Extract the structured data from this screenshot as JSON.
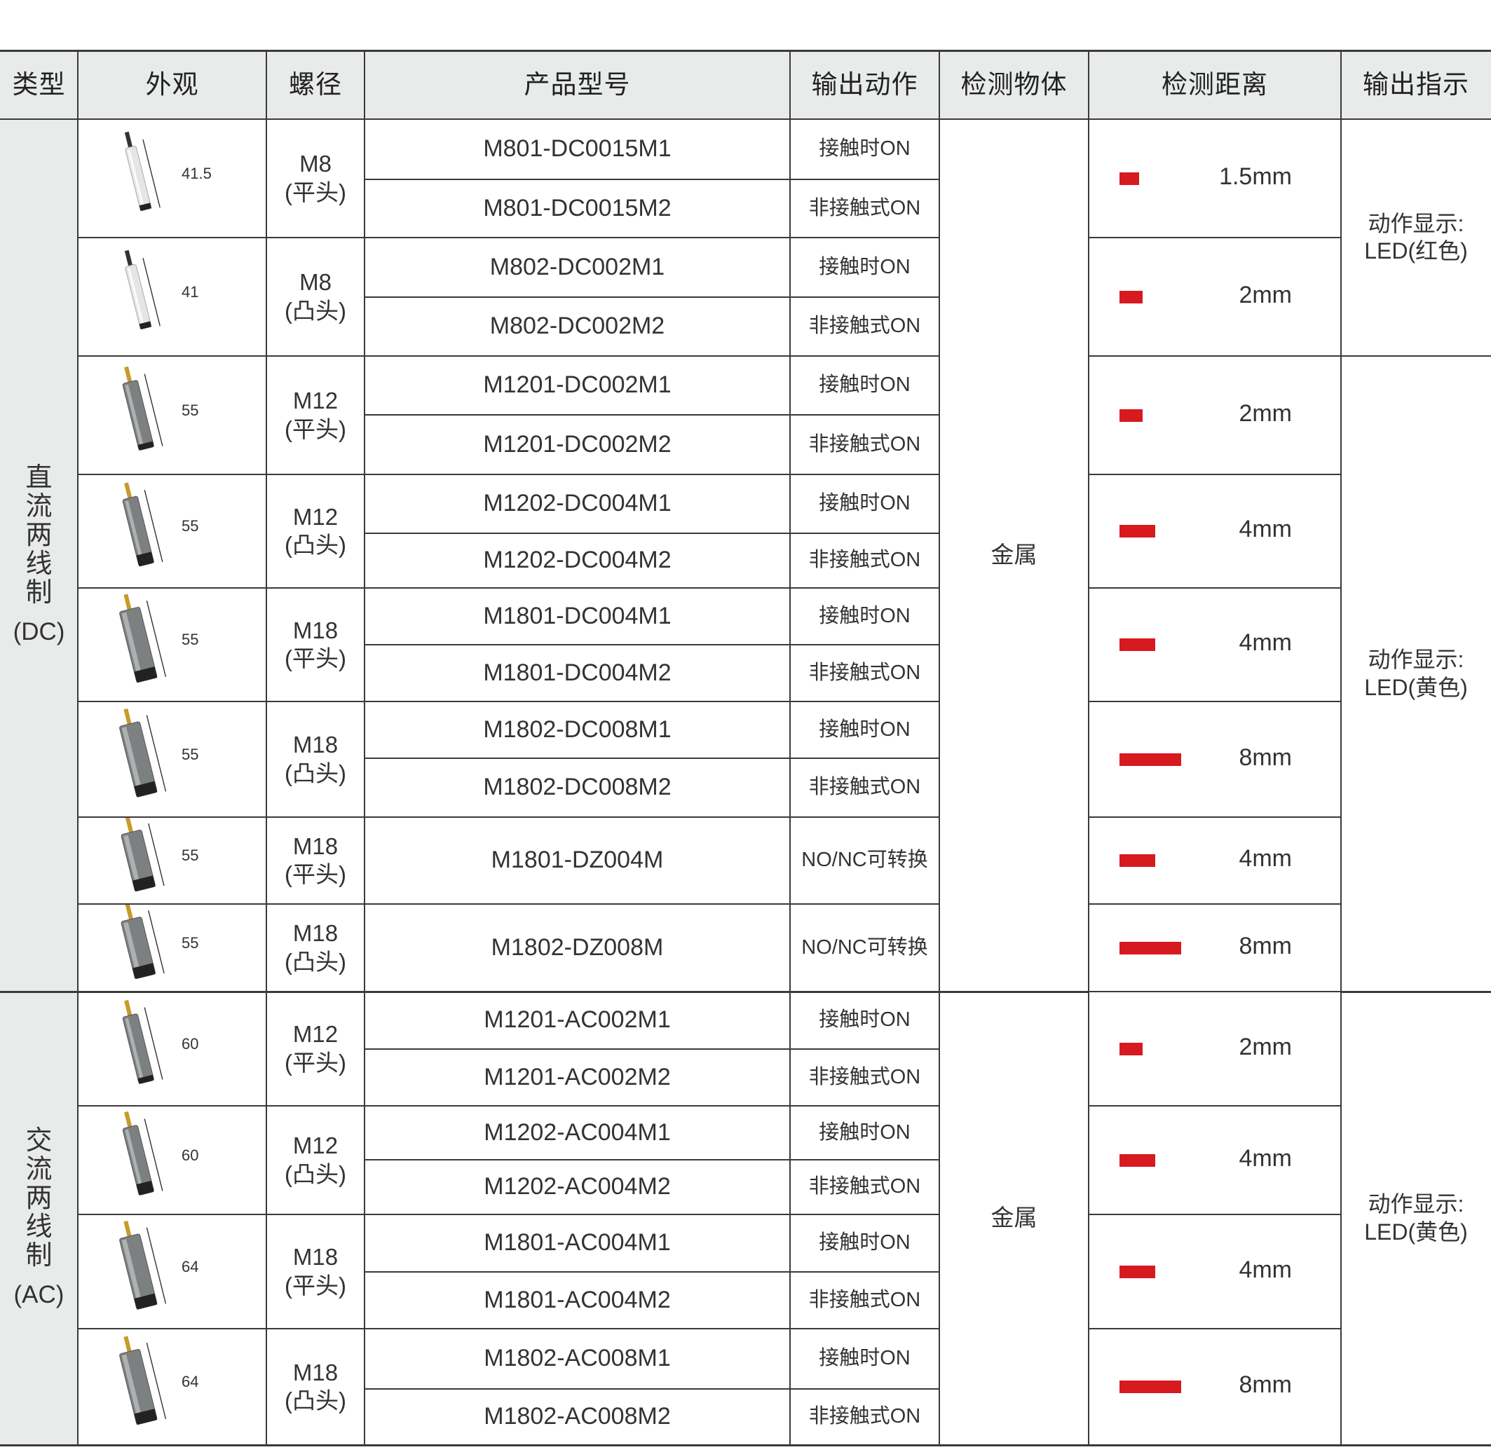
{
  "headers": [
    "类型",
    "外观",
    "螺径",
    "产品型号",
    "输出动作",
    "检测物体",
    "检测距离",
    "输出指示"
  ],
  "groups": [
    {
      "label_chars": [
        "直",
        "流",
        "两",
        "线",
        "制"
      ],
      "code": "(DC)",
      "detect_object": "金属"
    },
    {
      "label_chars": [
        "交",
        "流",
        "两",
        "线",
        "制"
      ],
      "code": "(AC)",
      "detect_object": "金属"
    }
  ],
  "products": [
    {
      "length": "41.5",
      "thread": "M8",
      "head": "(平头)",
      "distance": "1.5mm",
      "level": 1.5,
      "models": [
        {
          "model": "M801-DC0015M1",
          "action": "接触时ON"
        },
        {
          "model": "M801-DC0015M2",
          "action": "非接触式ON"
        }
      ]
    },
    {
      "length": "41",
      "thread": "M8",
      "head": "(凸头)",
      "distance": "2mm",
      "level": 2,
      "models": [
        {
          "model": "M802-DC002M1",
          "action": "接触时ON"
        },
        {
          "model": "M802-DC002M2",
          "action": "非接触式ON"
        }
      ]
    },
    {
      "length": "55",
      "thread": "M12",
      "head": "(平头)",
      "distance": "2mm",
      "level": 2,
      "models": [
        {
          "model": "M1201-DC002M1",
          "action": "接触时ON"
        },
        {
          "model": "M1201-DC002M2",
          "action": "非接触式ON"
        }
      ]
    },
    {
      "length": "55",
      "thread": "M12",
      "head": "(凸头)",
      "distance": "4mm",
      "level": 4,
      "models": [
        {
          "model": "M1202-DC004M1",
          "action": "接触时ON"
        },
        {
          "model": "M1202-DC004M2",
          "action": "非接触式ON"
        }
      ]
    },
    {
      "length": "55",
      "thread": "M18",
      "head": "(平头)",
      "distance": "4mm",
      "level": 4,
      "models": [
        {
          "model": "M1801-DC004M1",
          "action": "接触时ON"
        },
        {
          "model": "M1801-DC004M2",
          "action": "非接触式ON"
        }
      ]
    },
    {
      "length": "55",
      "thread": "M18",
      "head": "(凸头)",
      "distance": "8mm",
      "level": 8,
      "models": [
        {
          "model": "M1802-DC008M1",
          "action": "接触时ON"
        },
        {
          "model": "M1802-DC008M2",
          "action": "非接触式ON"
        }
      ]
    },
    {
      "length": "55",
      "thread": "M18",
      "head": "(平头)",
      "distance": "4mm",
      "level": 4,
      "models": [
        {
          "model": "M1801-DZ004M",
          "action": "NO/NC可转换"
        }
      ]
    },
    {
      "length": "55",
      "thread": "M18",
      "head": "(凸头)",
      "distance": "8mm",
      "level": 8,
      "models": [
        {
          "model": "M1802-DZ008M",
          "action": "NO/NC可转换"
        }
      ]
    },
    {
      "length": "60",
      "thread": "M12",
      "head": "(平头)",
      "distance": "2mm",
      "level": 2,
      "models": [
        {
          "model": "M1201-AC002M1",
          "action": "接触时ON"
        },
        {
          "model": "M1201-AC002M2",
          "action": "非接触式ON"
        }
      ]
    },
    {
      "length": "60",
      "thread": "M12",
      "head": "(凸头)",
      "distance": "4mm",
      "level": 4,
      "models": [
        {
          "model": "M1202-AC004M1",
          "action": "接触时ON"
        },
        {
          "model": "M1202-AC004M2",
          "action": "非接触式ON"
        }
      ]
    },
    {
      "length": "64",
      "thread": "M18",
      "head": "(平头)",
      "distance": "4mm",
      "level": 4,
      "models": [
        {
          "model": "M1801-AC004M1",
          "action": "接触时ON"
        },
        {
          "model": "M1801-AC004M2",
          "action": "非接触式ON"
        }
      ]
    },
    {
      "length": "64",
      "thread": "M18",
      "head": "(凸头)",
      "distance": "8mm",
      "level": 8,
      "models": [
        {
          "model": "M1802-AC008M1",
          "action": "接触时ON"
        },
        {
          "model": "M1802-AC008M2",
          "action": "非接触式ON"
        }
      ]
    }
  ],
  "indicators": [
    {
      "line1": "动作显示:",
      "line2": "LED(红色)"
    },
    {
      "line1": "动作显示:",
      "line2": "LED(黄色)"
    },
    {
      "line1": "动作显示:",
      "line2": "LED(黄色)"
    }
  ],
  "colors": {
    "accent": "#d71920",
    "header_bg": "#e8ebea",
    "type_bg": "#e8ebea",
    "rule": "#3a3a3a"
  }
}
